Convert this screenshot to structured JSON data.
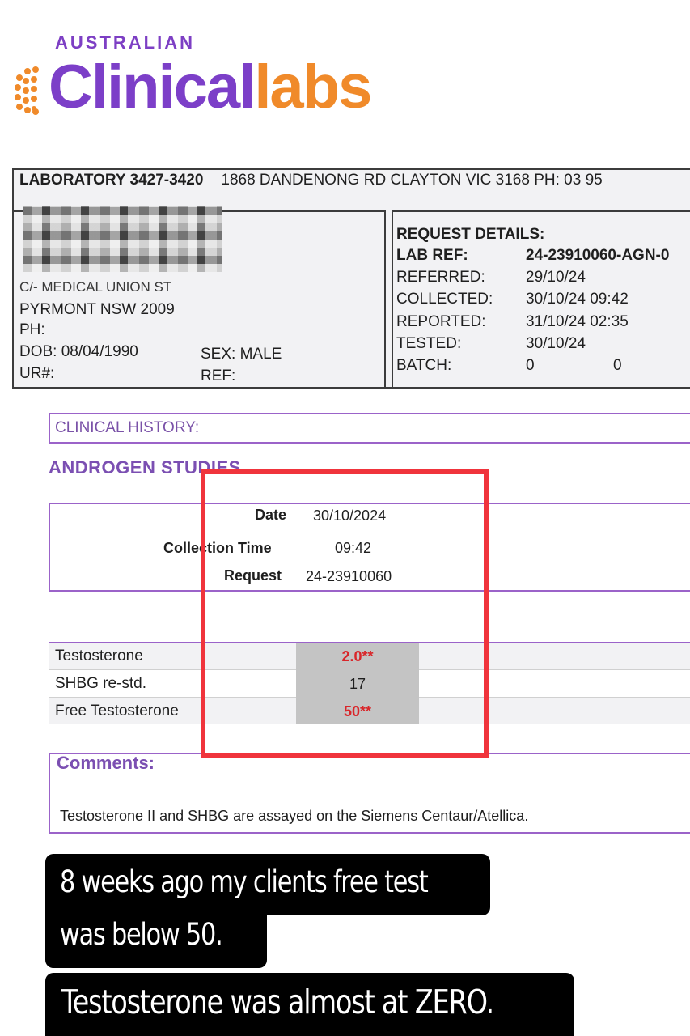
{
  "logo": {
    "top_line": "AUSTRALIAN",
    "main_purple": "Clinical",
    "main_orange": "labs",
    "purple": "#7c3fc8",
    "orange": "#f08a2a"
  },
  "lab_header": {
    "lab_id": "LABORATORY 3427-3420",
    "address": "1868 DANDENONG RD  CLAYTON  VIC  3168  PH: 03 95"
  },
  "patient": {
    "address_partial": "C/- MEDICAL  UNION ST",
    "suburb": "PYRMONT NSW 2009",
    "ph_label": "PH:",
    "dob": "DOB: 08/04/1990",
    "sex": "SEX:  MALE",
    "ur": "UR#:",
    "ref": "REF:"
  },
  "request_details": {
    "title": "REQUEST DETAILS:",
    "rows": [
      {
        "label": "LAB REF:",
        "value": "24-23910060-AGN-0"
      },
      {
        "label": "REFERRED:",
        "value": "29/10/24"
      },
      {
        "label": "COLLECTED:",
        "value": "30/10/24 09:42"
      },
      {
        "label": "REPORTED:",
        "value": "31/10/24 02:35"
      },
      {
        "label": "TESTED:",
        "value": "30/10/24"
      },
      {
        "label": "BATCH:",
        "value": "0",
        "value2": "0"
      }
    ]
  },
  "clinical_history_label": "CLINICAL HISTORY:",
  "section_title": "ANDROGEN STUDIES",
  "collection": {
    "date_label": "Date",
    "date_value": "30/10/2024",
    "time_label": "Collection Time",
    "time_value": "09:42",
    "request_label": "Request",
    "request_value": "24-23910060"
  },
  "results": [
    {
      "name": "Testosterone",
      "value": "2.0**",
      "flagged": true
    },
    {
      "name": "SHBG re-std.",
      "value": "17",
      "flagged": false
    },
    {
      "name": "Free Testosterone",
      "value": "50**",
      "flagged": true
    }
  ],
  "comments": {
    "title": "Comments:",
    "text": "Testosterone II and SHBG are assayed on the Siemens Centaur/Atellica."
  },
  "captions": {
    "line1a": "8 weeks ago my clients free test",
    "line1b": "was below  50.",
    "line2": "Testosterone was almost at ZERO."
  },
  "highlight_color": "#f0343c",
  "flag_color": "#d9262a"
}
